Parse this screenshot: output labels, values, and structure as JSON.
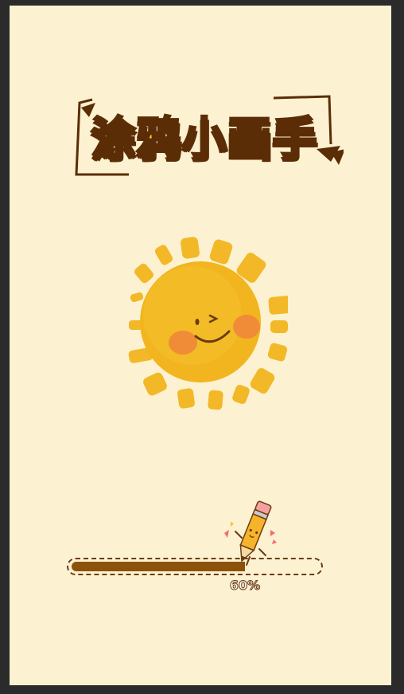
{
  "game": {
    "title": "涂鸦小画手"
  },
  "loading": {
    "progress": 0.6,
    "percent_text": "60%"
  },
  "colors": {
    "background": "#fcf1d0",
    "title_fill": "#ffd21a",
    "title_outline": "#5b2d06",
    "progress_fill": "#8c520b",
    "progress_border": "#6b3b12",
    "sun": "#f2b51f",
    "cheek": "#f0873a"
  },
  "icons": {
    "mascot": "smiling-sun-icon",
    "loader": "walking-pencil-icon"
  }
}
